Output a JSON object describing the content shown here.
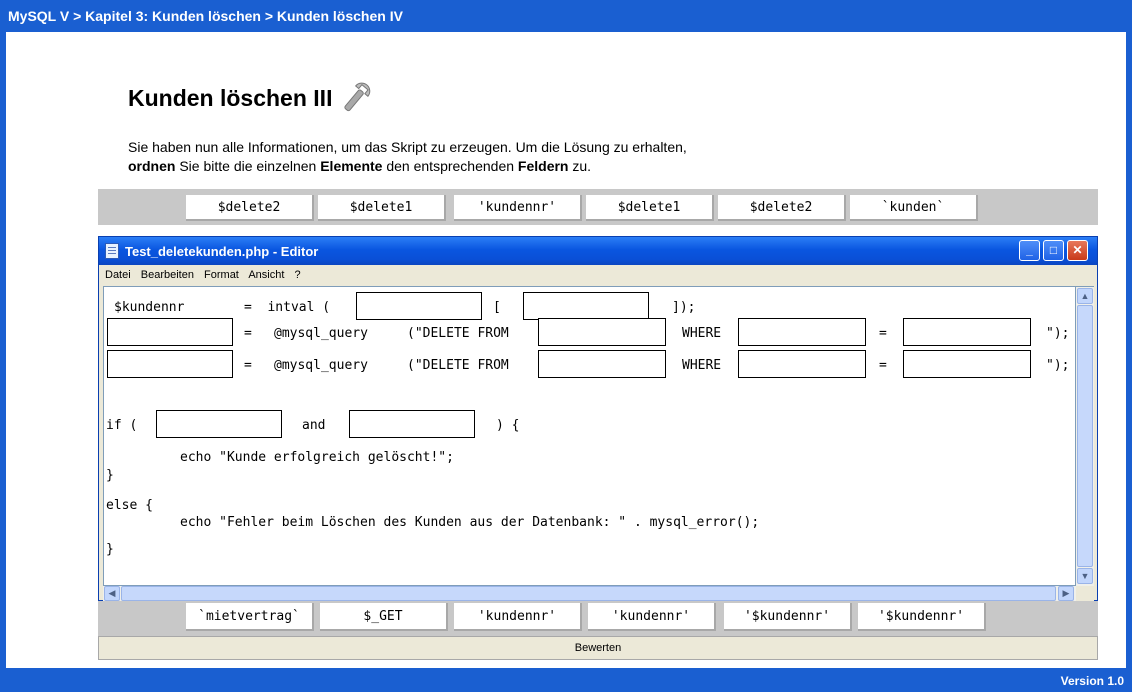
{
  "breadcrumb": "MySQL V > Kapitel 3: Kunden löschen > Kunden löschen IV",
  "page_title": "Kunden löschen III",
  "intro": {
    "line1": "Sie haben nun alle Informationen, um das Skript zu erzeugen. Um die Lösung zu erhalten,",
    "b1": "ordnen",
    "t1": " Sie bitte die einzelnen ",
    "b2": "Elemente",
    "t2": " den entsprechenden ",
    "b3": "Feldern",
    "t3": " zu."
  },
  "tokens_top": [
    "$delete2",
    "$delete1",
    "'kundennr'",
    "$delete1",
    "$delete2",
    "`kunden`"
  ],
  "tokens_bottom": [
    "`mietvertrag`",
    "$_GET",
    "'kundennr'",
    "'kundennr'",
    "'$kundennr'",
    "'$kundennr'"
  ],
  "editor": {
    "title": "Test_deletekunden.php - Editor",
    "menu": [
      "Datei",
      "Bearbeiten",
      "Format",
      "Ansicht",
      "?"
    ]
  },
  "code": {
    "var_kundennr": "$kundennr",
    "assign_intval": "=  intval (",
    "open_bracket": "[",
    "close_bracket": "]);",
    "assign_1": "=",
    "query_1": "@mysql_query",
    "delete_1": "(\"DELETE FROM",
    "where_1": "WHERE",
    "eq_1": "=",
    "end_1": "\");",
    "assign_2": "=",
    "query_2": "@mysql_query",
    "delete_2": "(\"DELETE FROM",
    "where_2": "WHERE",
    "eq_2": "=",
    "end_2": "\");",
    "if_open": "if (",
    "and": "and",
    "if_close": ") {",
    "echo_ok": "echo \"Kunde erfolgreich gelöscht!\";",
    "brace_1": "}",
    "else": "else {",
    "echo_err": "echo \"Fehler beim Löschen des Kunden aus der Datenbank: \" . mysql_error();",
    "brace_2": "}"
  },
  "bewerten_label": "Bewerten",
  "version": "Version 1.0"
}
